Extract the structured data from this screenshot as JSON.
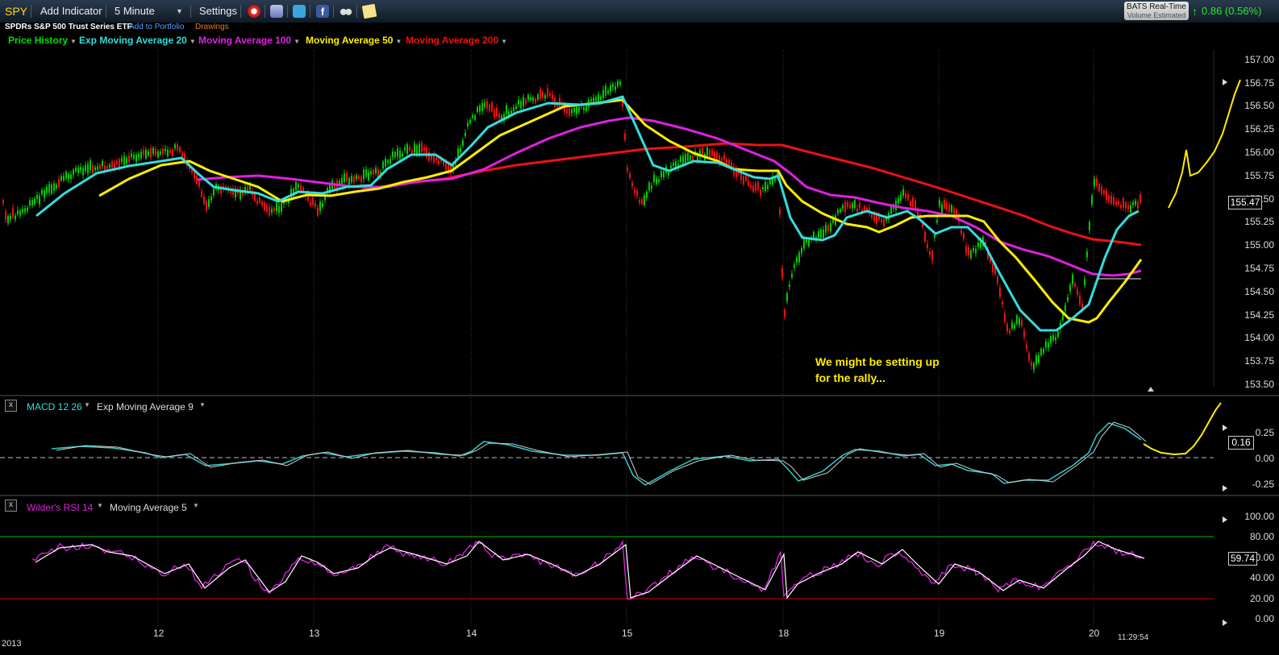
{
  "toolbar": {
    "symbol": "SPY",
    "add_indicator": "Add Indicator",
    "interval": "5 Minute",
    "settings": "Settings",
    "feed_title": "BATS Real-Time",
    "feed_sub": "Volume Estimated",
    "change": "0.86 (0.56%)",
    "icons": [
      "alarm-clock-icon",
      "news-stack-icon",
      "twitter-icon",
      "facebook-icon",
      "binoculars-icon",
      "note-icon"
    ]
  },
  "subheader": {
    "security_name": "SPDRs S&P 500 Trust Series ETF",
    "add_to_portfolio": "Add to Portfolio",
    "drawings": "Drawings"
  },
  "studies": [
    {
      "label": "Price History",
      "color": "#00e000"
    },
    {
      "label": "Exp Moving Average 20",
      "color": "#33dddd"
    },
    {
      "label": "Moving Average 100",
      "color": "#e020e0"
    },
    {
      "label": "Moving Average 50",
      "color": "#ffee00"
    },
    {
      "label": "Moving Average 200",
      "color": "#ee1111"
    }
  ],
  "price_axis": [
    "157.00",
    "156.75",
    "156.50",
    "156.25",
    "156.00",
    "155.75",
    "155.50",
    "155.25",
    "155.00",
    "154.75",
    "154.50",
    "154.25",
    "154.00",
    "153.75",
    "153.50"
  ],
  "current_price": "155.47",
  "annotation": [
    "We might be setting up",
    "for the rally..."
  ],
  "macd": {
    "label": "MACD 12 26",
    "signal_label": "Exp Moving Average 9",
    "axis": [
      "0.25",
      "0.00",
      "-0.25"
    ],
    "current": "0.16"
  },
  "rsi": {
    "label": "Wilder's RSI 14",
    "ma_label": "Moving Average 5",
    "axis": [
      "100.00",
      "80.00",
      "60.00",
      "40.00",
      "20.00",
      "0.00"
    ],
    "current": "59.74"
  },
  "x_axis": {
    "year": "2013",
    "dates": [
      "12",
      "13",
      "14",
      "15",
      "18",
      "19",
      "20"
    ],
    "time": "11:29:54"
  },
  "colors": {
    "price_up": "#00cc00",
    "price_down": "#ee1111",
    "ema20": "#33dddd",
    "ma100": "#e020e0",
    "ma50": "#ffee00",
    "ma200": "#ee1111",
    "macd": "#33cccc",
    "macd_signal": "#cccccc",
    "rsi": "#dd22dd",
    "rsi_ma": "#ffffff",
    "overbought": "#00bb00",
    "oversold": "#cc0000"
  }
}
